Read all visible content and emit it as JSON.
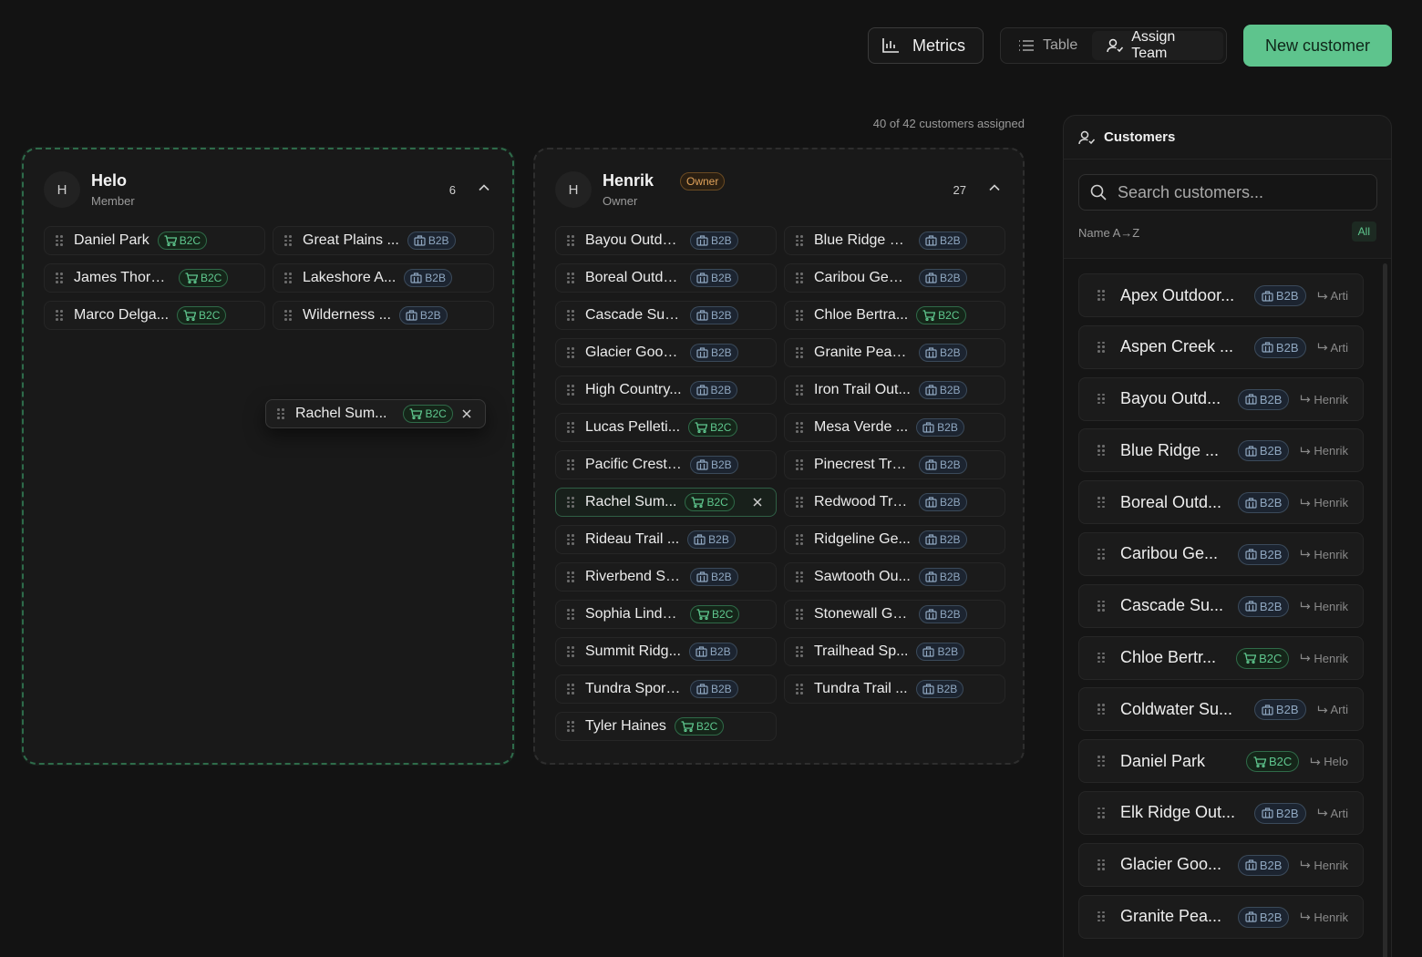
{
  "toolbar": {
    "metrics_label": "Metrics",
    "table_label": "Table",
    "assign_label": "Assign Team",
    "new_customer_label": "New customer"
  },
  "assigned_summary": "40 of 42 customers assigned",
  "teams": {
    "helo": {
      "initial": "H",
      "name": "Helo",
      "role": "Member",
      "count": "6",
      "customers": [
        {
          "name": "Daniel Park",
          "type": "B2C"
        },
        {
          "name": "Great Plains ...",
          "type": "B2B"
        },
        {
          "name": "James Thorn...",
          "type": "B2C"
        },
        {
          "name": "Lakeshore A...",
          "type": "B2B"
        },
        {
          "name": "Marco Delga...",
          "type": "B2C"
        },
        {
          "name": "Wilderness ...",
          "type": "B2B"
        }
      ]
    },
    "henrik": {
      "initial": "H",
      "name": "Henrik",
      "badge": "Owner",
      "role": "Owner",
      "count": "27",
      "customers": [
        {
          "name": "Bayou Outdo...",
          "type": "B2B"
        },
        {
          "name": "Blue Ridge M...",
          "type": "B2B"
        },
        {
          "name": "Boreal Outdo...",
          "type": "B2B"
        },
        {
          "name": "Caribou Gear...",
          "type": "B2B"
        },
        {
          "name": "Cascade Sup...",
          "type": "B2B"
        },
        {
          "name": "Chloe Bertra...",
          "type": "B2C"
        },
        {
          "name": "Glacier Good...",
          "type": "B2B"
        },
        {
          "name": "Granite Peak...",
          "type": "B2B"
        },
        {
          "name": "High Country...",
          "type": "B2B"
        },
        {
          "name": "Iron Trail Out...",
          "type": "B2B"
        },
        {
          "name": "Lucas Pelleti...",
          "type": "B2C"
        },
        {
          "name": "Mesa Verde ...",
          "type": "B2B"
        },
        {
          "name": "Pacific Crest ...",
          "type": "B2B"
        },
        {
          "name": "Pinecrest Tra...",
          "type": "B2B"
        },
        {
          "name": "Rachel Sum...",
          "type": "B2C",
          "selected": true
        },
        {
          "name": "Redwood Tra...",
          "type": "B2B"
        },
        {
          "name": "Rideau Trail ...",
          "type": "B2B"
        },
        {
          "name": "Ridgeline Ge...",
          "type": "B2B"
        },
        {
          "name": "Riverbend Sp...",
          "type": "B2B"
        },
        {
          "name": "Sawtooth Ou...",
          "type": "B2B"
        },
        {
          "name": "Sophia Lindq...",
          "type": "B2C"
        },
        {
          "name": "Stonewall Ge...",
          "type": "B2B"
        },
        {
          "name": "Summit Ridg...",
          "type": "B2B"
        },
        {
          "name": "Trailhead Sp...",
          "type": "B2B"
        },
        {
          "name": "Tundra Sport...",
          "type": "B2B"
        },
        {
          "name": "Tundra Trail ...",
          "type": "B2B"
        },
        {
          "name": "Tyler Haines",
          "type": "B2C"
        }
      ]
    }
  },
  "dragging": {
    "name": "Rachel Sum...",
    "type": "B2C"
  },
  "panel": {
    "title": "Customers",
    "search_placeholder": "Search customers...",
    "sort_label": "Name A→Z",
    "filter_label": "All",
    "customers": [
      {
        "name": "Apex Outdoor...",
        "type": "B2B",
        "team": "Arti"
      },
      {
        "name": "Aspen Creek ...",
        "type": "B2B",
        "team": "Arti"
      },
      {
        "name": "Bayou Outd...",
        "type": "B2B",
        "team": "Henrik"
      },
      {
        "name": "Blue Ridge ...",
        "type": "B2B",
        "team": "Henrik"
      },
      {
        "name": "Boreal Outd...",
        "type": "B2B",
        "team": "Henrik"
      },
      {
        "name": "Caribou Ge...",
        "type": "B2B",
        "team": "Henrik"
      },
      {
        "name": "Cascade Su...",
        "type": "B2B",
        "team": "Henrik"
      },
      {
        "name": "Chloe Bertr...",
        "type": "B2C",
        "team": "Henrik"
      },
      {
        "name": "Coldwater Su...",
        "type": "B2B",
        "team": "Arti"
      },
      {
        "name": "Daniel Park",
        "type": "B2C",
        "team": "Helo"
      },
      {
        "name": "Elk Ridge Out...",
        "type": "B2B",
        "team": "Arti"
      },
      {
        "name": "Glacier Goo...",
        "type": "B2B",
        "team": "Henrik"
      },
      {
        "name": "Granite Pea...",
        "type": "B2B",
        "team": "Henrik"
      }
    ]
  },
  "colors": {
    "accent": "#5ec48d",
    "b2c": "#5fc78e",
    "b2b": "#8fa7c0",
    "owner": "#e0a25a",
    "background": "#131313"
  },
  "icons": {
    "metrics": "bar-chart-icon",
    "table": "list-icon",
    "assign": "user-plus-icon",
    "b2b": "building-icon",
    "b2c": "cart-icon",
    "team_link": "return-arrow-icon"
  }
}
